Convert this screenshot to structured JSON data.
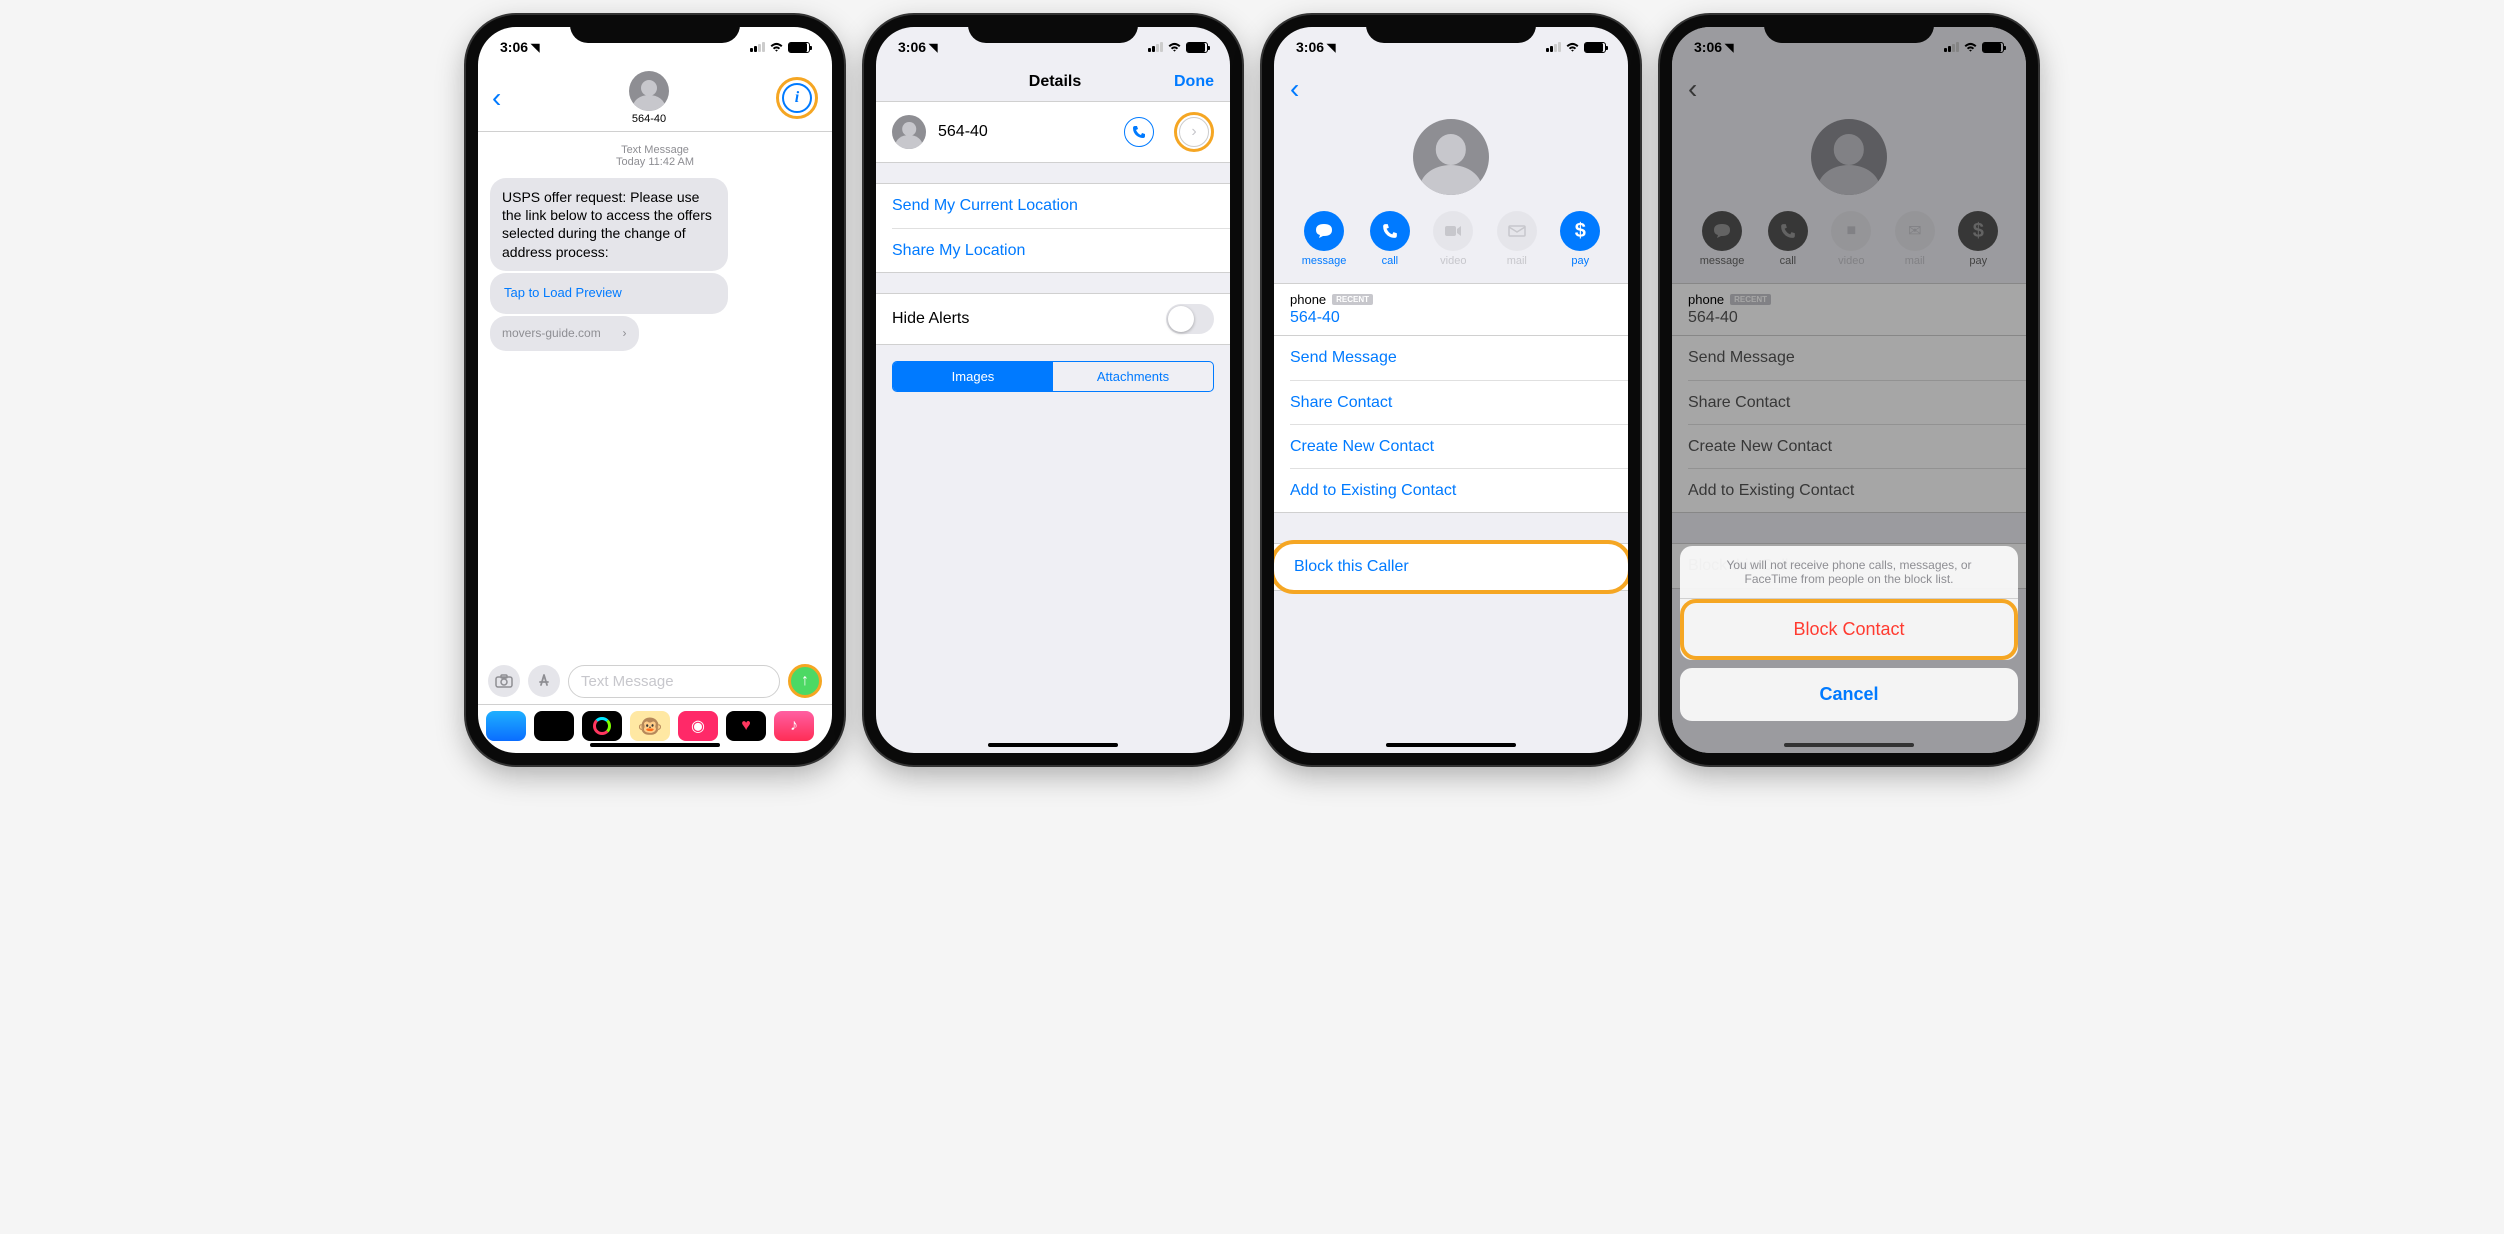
{
  "status": {
    "time": "3:06",
    "loc_arrow": "➤"
  },
  "screen1": {
    "contact_number": "564-40",
    "msg_date_label": "Text Message",
    "msg_date": "Today",
    "msg_time": "11:42 AM",
    "message_body": "USPS offer request: Please use the link below to access the offers selected during the change of address process:",
    "tap_preview": "Tap to Load Preview",
    "domain": "movers-guide.com",
    "input_placeholder": "Text Message",
    "info_symbol": "i"
  },
  "screen2": {
    "title": "Details",
    "done": "Done",
    "contact": "564-40",
    "send_location": "Send My Current Location",
    "share_location": "Share My Location",
    "hide_alerts": "Hide Alerts",
    "seg_images": "Images",
    "seg_attachments": "Attachments"
  },
  "contact_card": {
    "actions": {
      "message": "message",
      "call": "call",
      "video": "video",
      "mail": "mail",
      "pay": "pay"
    },
    "phone_label": "phone",
    "recent_badge": "RECENT",
    "phone_value": "564-40",
    "send_message": "Send Message",
    "share_contact": "Share Contact",
    "create_contact": "Create New Contact",
    "add_existing": "Add to Existing Contact",
    "block_caller": "Block this Caller"
  },
  "action_sheet": {
    "warning": "You will not receive phone calls, messages, or FaceTime from people on the block list.",
    "block": "Block Contact",
    "cancel": "Cancel"
  }
}
